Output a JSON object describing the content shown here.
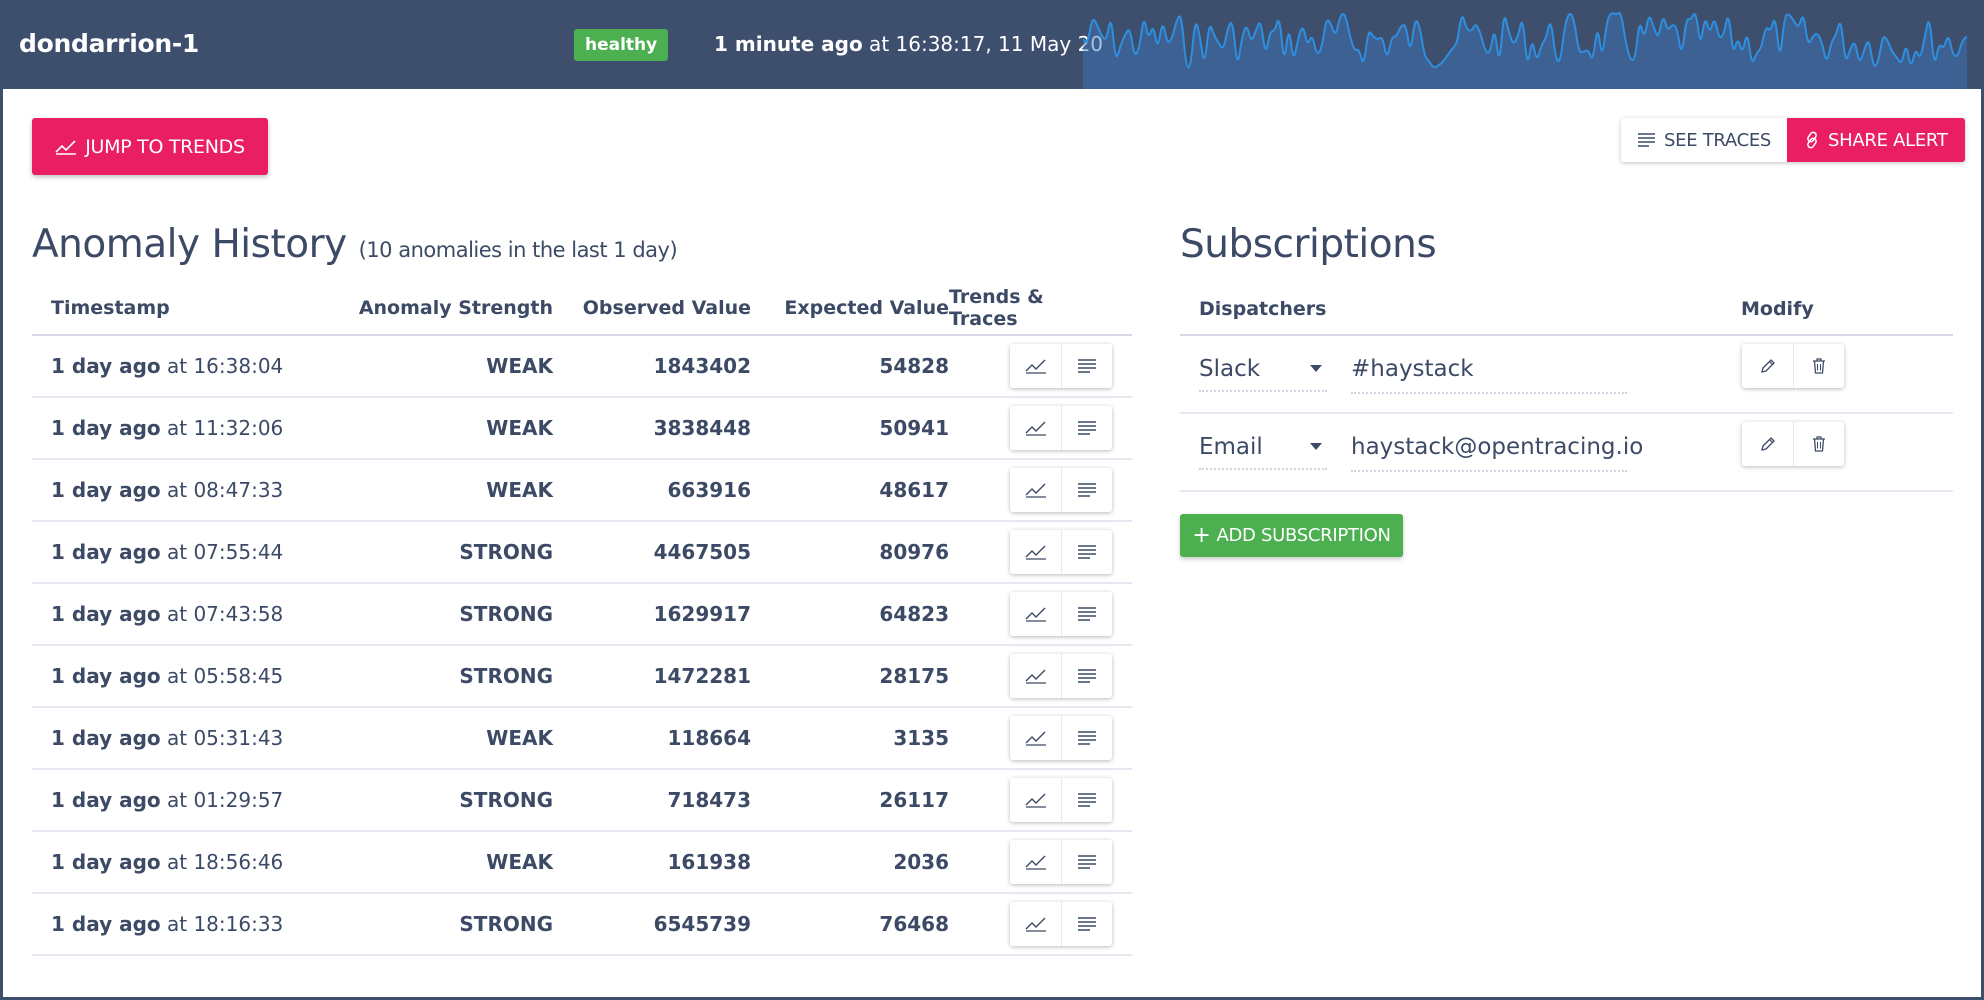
{
  "header": {
    "title": "dondarrion-1",
    "status": "healthy",
    "last_check_relative": "1 minute ago",
    "last_check_detail": " at 16:38:17, 11 May 20",
    "status_color": "#4caf50",
    "bar_color": "#3e4e6d",
    "sparkline_color": "#2e8fe0"
  },
  "actions": {
    "jump_to_trends": "JUMP TO TRENDS",
    "see_traces": "SEE TRACES",
    "share_alert": "SHARE ALERT",
    "accent_color": "#e91e63"
  },
  "history": {
    "title": "Anomaly History",
    "subtitle": "(10 anomalies in the last 1 day)",
    "columns": [
      "Timestamp",
      "Anomaly Strength",
      "Observed Value",
      "Expected Value",
      "Trends & Traces"
    ],
    "rows": [
      {
        "ago": "1 day ago",
        "time": " at 16:38:04",
        "strength": "WEAK",
        "observed": "1843402",
        "expected": "54828"
      },
      {
        "ago": "1 day ago",
        "time": " at 11:32:06",
        "strength": "WEAK",
        "observed": "3838448",
        "expected": "50941"
      },
      {
        "ago": "1 day ago",
        "time": " at 08:47:33",
        "strength": "WEAK",
        "observed": "663916",
        "expected": "48617"
      },
      {
        "ago": "1 day ago",
        "time": " at 07:55:44",
        "strength": "STRONG",
        "observed": "4467505",
        "expected": "80976"
      },
      {
        "ago": "1 day ago",
        "time": " at 07:43:58",
        "strength": "STRONG",
        "observed": "1629917",
        "expected": "64823"
      },
      {
        "ago": "1 day ago",
        "time": " at 05:58:45",
        "strength": "STRONG",
        "observed": "1472281",
        "expected": "28175"
      },
      {
        "ago": "1 day ago",
        "time": " at 05:31:43",
        "strength": "WEAK",
        "observed": "118664",
        "expected": "3135"
      },
      {
        "ago": "1 day ago",
        "time": " at 01:29:57",
        "strength": "STRONG",
        "observed": "718473",
        "expected": "26117"
      },
      {
        "ago": "1 day ago",
        "time": " at 18:56:46",
        "strength": "WEAK",
        "observed": "161938",
        "expected": "2036"
      },
      {
        "ago": "1 day ago",
        "time": " at 18:16:33",
        "strength": "STRONG",
        "observed": "6545739",
        "expected": "76468"
      }
    ],
    "row_icons": [
      "trend-icon",
      "traces-icon"
    ]
  },
  "subscriptions": {
    "title": "Subscriptions",
    "columns": [
      "Dispatchers",
      "Modify"
    ],
    "items": [
      {
        "type": "Slack",
        "endpoint": "#haystack"
      },
      {
        "type": "Email",
        "endpoint": "haystack@opentracing.io"
      }
    ],
    "add_label": "ADD SUBSCRIPTION",
    "add_color": "#4caf50"
  }
}
